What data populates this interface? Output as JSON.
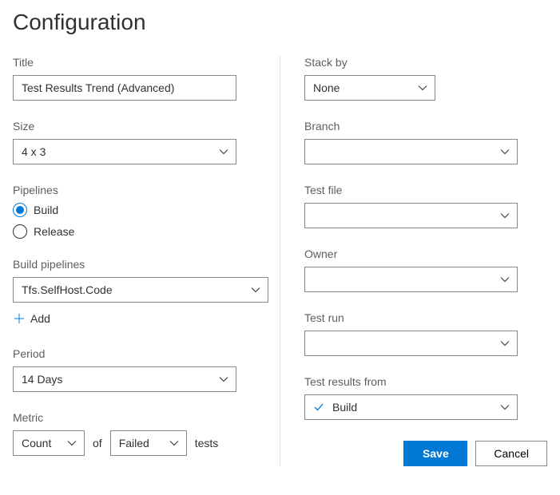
{
  "page_title": "Configuration",
  "left": {
    "title": {
      "label": "Title",
      "value": "Test Results Trend (Advanced)"
    },
    "size": {
      "label": "Size",
      "value": "4 x 3"
    },
    "pipelines": {
      "label": "Pipelines",
      "options": [
        {
          "label": "Build",
          "selected": true
        },
        {
          "label": "Release",
          "selected": false
        }
      ]
    },
    "build_pipelines": {
      "label": "Build pipelines",
      "value": "Tfs.SelfHost.Code",
      "add_label": "Add"
    },
    "period": {
      "label": "Period",
      "value": "14 Days"
    },
    "metric": {
      "label": "Metric",
      "count": "Count",
      "of": "of",
      "status": "Failed",
      "tests": "tests"
    }
  },
  "right": {
    "stack_by": {
      "label": "Stack by",
      "value": "None"
    },
    "branch": {
      "label": "Branch",
      "value": ""
    },
    "test_file": {
      "label": "Test file",
      "value": ""
    },
    "owner": {
      "label": "Owner",
      "value": ""
    },
    "test_run": {
      "label": "Test run",
      "value": ""
    },
    "test_results_from": {
      "label": "Test results from",
      "value": "Build"
    }
  },
  "buttons": {
    "save": "Save",
    "cancel": "Cancel"
  }
}
